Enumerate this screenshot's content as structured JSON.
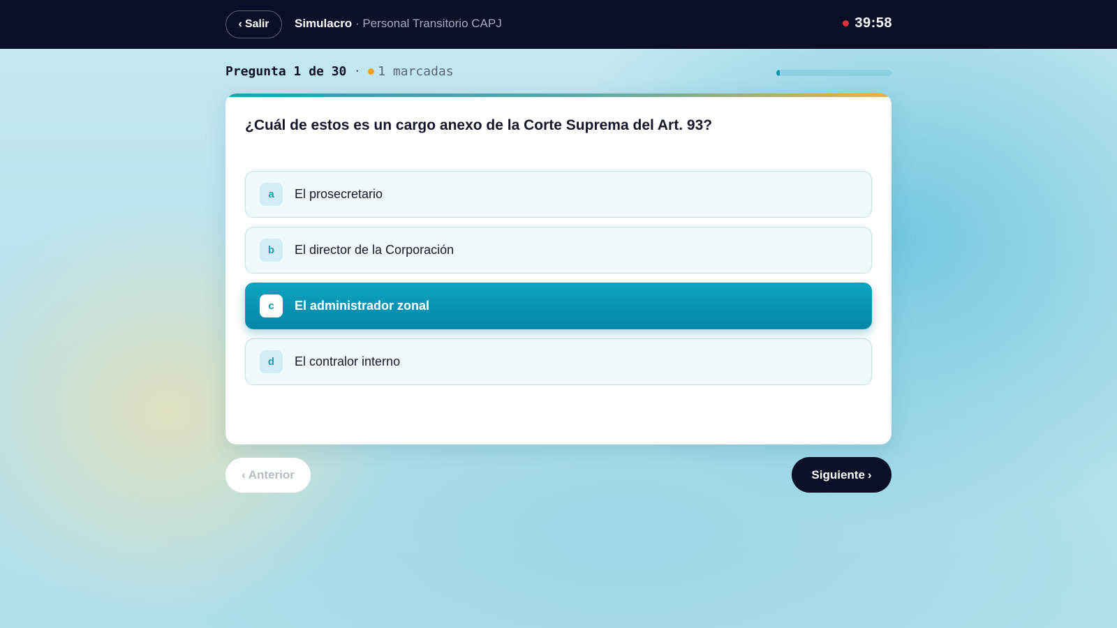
{
  "topbar": {
    "exit_label": "Salir",
    "chevron_left": "‹",
    "title": "Simulacro",
    "separator": "·",
    "subtitle": "Personal Transitorio CAPJ",
    "timer": "39:58",
    "timer_dot_color": "#e0303a"
  },
  "status": {
    "question_counter": "Pregunta 1 de 30",
    "separator": "·",
    "marked": "1 marcadas",
    "marked_dot_color": "#f0a020",
    "progress_fraction": 0.033
  },
  "question": {
    "text": "¿Cuál de estos es un cargo anexo de la Corte Suprema del Art. 93?",
    "options": [
      {
        "letter": "a",
        "text": "El prosecretario",
        "selected": false
      },
      {
        "letter": "b",
        "text": "El director de la Corporación",
        "selected": false
      },
      {
        "letter": "c",
        "text": "El administrador zonal",
        "selected": true
      },
      {
        "letter": "d",
        "text": "El contralor interno",
        "selected": false
      }
    ]
  },
  "nav": {
    "prev_label": "Anterior",
    "prev_chevron": "‹",
    "next_label": "Siguiente",
    "next_chevron": "›"
  },
  "colors": {
    "accent": "#0a9fbe",
    "dark": "#0b0e27"
  }
}
